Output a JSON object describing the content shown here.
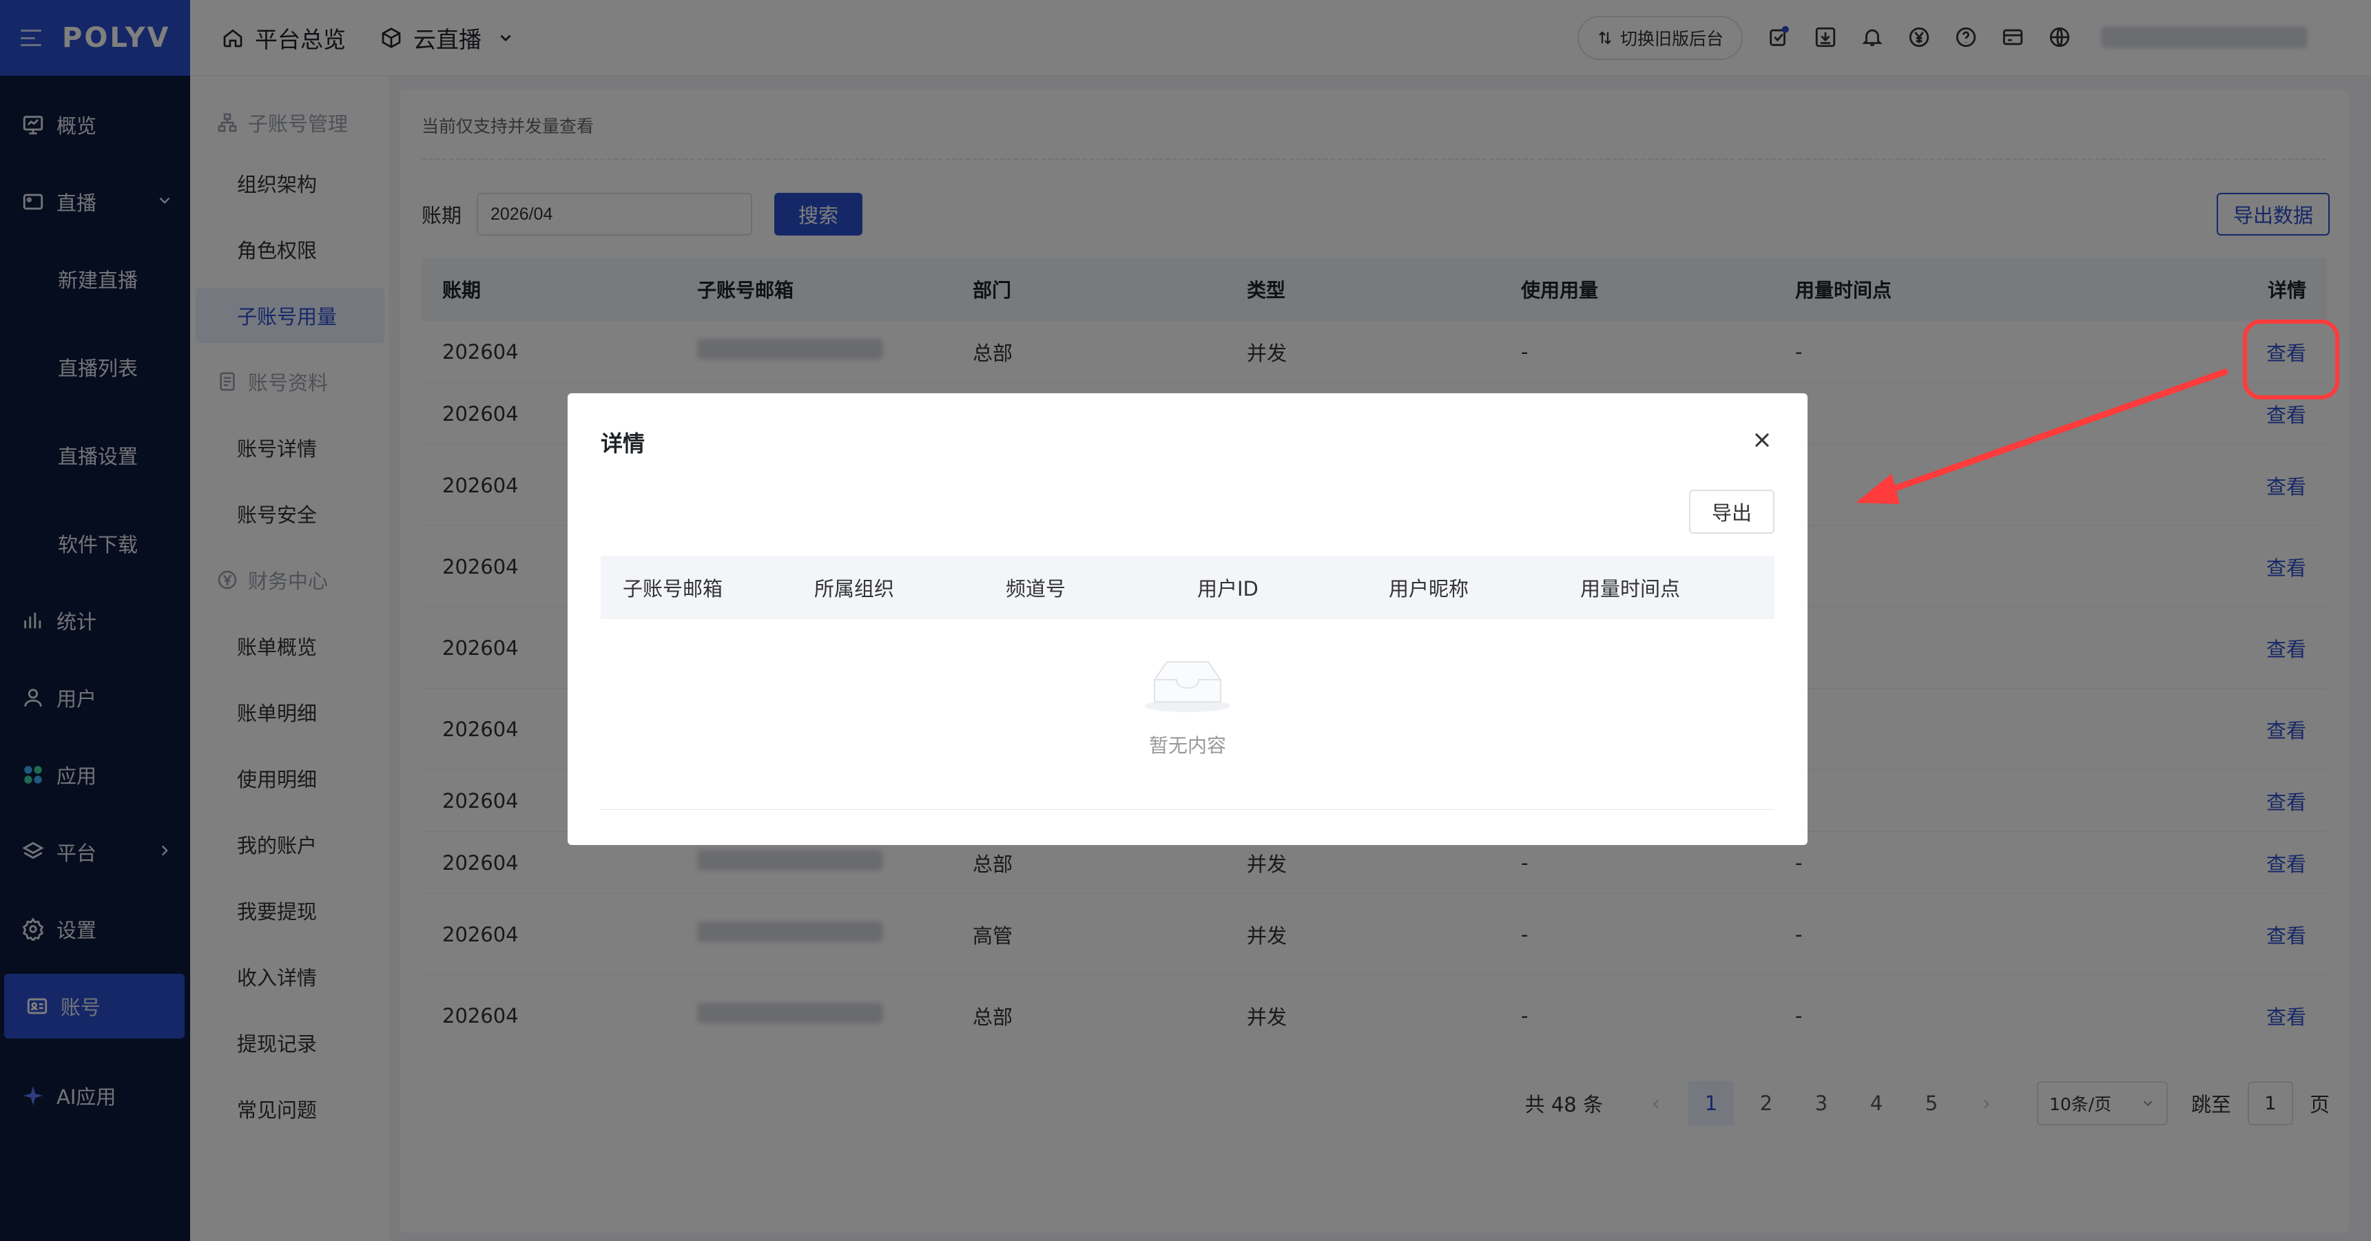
{
  "header": {
    "logo": "POLYV",
    "nav_overview": "平台总览",
    "nav_live": "云直播",
    "switch_old": "切换旧版后台"
  },
  "sidebar": {
    "items": [
      {
        "label": "概览",
        "icon": "monitor-icon"
      },
      {
        "label": "直播",
        "icon": "video-icon"
      },
      {
        "label": "新建直播"
      },
      {
        "label": "直播列表"
      },
      {
        "label": "直播设置"
      },
      {
        "label": "软件下载"
      },
      {
        "label": "统计",
        "icon": "bar-chart-icon"
      },
      {
        "label": "用户",
        "icon": "user-icon"
      },
      {
        "label": "应用",
        "icon": "apps-icon"
      },
      {
        "label": "平台",
        "icon": "layers-icon"
      },
      {
        "label": "设置",
        "icon": "gear-icon"
      },
      {
        "label": "账号",
        "icon": "id-card-icon"
      },
      {
        "label": "AI应用",
        "icon": "sparkle-icon"
      }
    ]
  },
  "submenu": {
    "group1": "子账号管理",
    "org": "组织架构",
    "roles": "角色权限",
    "usage": "子账号用量",
    "group2": "账号资料",
    "detail": "账号详情",
    "security": "账号安全",
    "group3": "财务中心",
    "bill_overview": "账单概览",
    "bill_detail": "账单明细",
    "usage_detail": "使用明细",
    "my_account": "我的账户",
    "withdraw": "我要提现",
    "income": "收入详情",
    "withdraw_log": "提现记录",
    "faq": "常见问题"
  },
  "main": {
    "notice": "当前仅支持并发量查看",
    "period_label": "账期",
    "period_value": "2026/04",
    "search": "搜索",
    "export_data": "导出数据",
    "columns": [
      "账期",
      "子账号邮箱",
      "部门",
      "类型",
      "使用用量",
      "用量时间点",
      "详情"
    ],
    "rows": [
      {
        "period": "202604",
        "dept": "总部",
        "type": "并发",
        "usage": "-",
        "time": "-",
        "action": "查看"
      },
      {
        "period": "202604",
        "dept": "",
        "type": "",
        "usage": "",
        "time": "-",
        "action": "查看"
      },
      {
        "period": "202604",
        "dept": "",
        "type": "",
        "usage": "",
        "time": "-",
        "action": "查看"
      },
      {
        "period": "202604",
        "dept": "",
        "type": "",
        "usage": "",
        "time": "-",
        "action": "查看"
      },
      {
        "period": "202604",
        "dept": "",
        "type": "",
        "usage": "",
        "time": "-",
        "action": "查看"
      },
      {
        "period": "202604",
        "dept": "",
        "type": "",
        "usage": "",
        "time": "-",
        "action": "查看"
      },
      {
        "period": "202604",
        "dept": "",
        "type": "",
        "usage": "",
        "time": "-",
        "action": "查看"
      },
      {
        "period": "202604",
        "dept": "总部",
        "type": "并发",
        "usage": "-",
        "time": "-",
        "action": "查看"
      },
      {
        "period": "202604",
        "dept": "高管",
        "type": "并发",
        "usage": "-",
        "time": "-",
        "action": "查看"
      },
      {
        "period": "202604",
        "dept": "总部",
        "type": "并发",
        "usage": "-",
        "time": "-",
        "action": "查看"
      }
    ],
    "pager": {
      "total": "共 48 条",
      "pages": [
        "1",
        "2",
        "3",
        "4",
        "5"
      ],
      "prev": "‹",
      "next": "›",
      "page_size": "10条/页",
      "jump_label": "跳至",
      "jump_value": "1",
      "page_suffix": "页"
    }
  },
  "dialog": {
    "title": "详情",
    "export": "导出",
    "columns": [
      "子账号邮箱",
      "所属组织",
      "频道号",
      "用户ID",
      "用户昵称",
      "用量时间点"
    ],
    "empty": "暂无内容"
  },
  "colors": {
    "brand": "#2b4fce",
    "sidebar_bg": "#0c1b3d",
    "annotation": "#ff3b3b"
  }
}
